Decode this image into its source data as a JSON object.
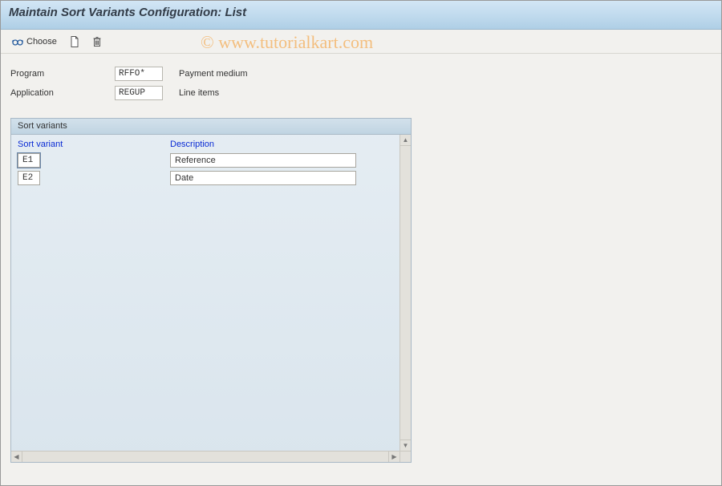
{
  "title_bar": {
    "title": "Maintain Sort Variants Configuration: List"
  },
  "toolbar": {
    "choose_label": "Choose"
  },
  "form": {
    "program_label": "Program",
    "program_value": "RFFO*",
    "program_desc": "Payment medium",
    "application_label": "Application",
    "application_value": "REGUP",
    "application_desc": "Line items"
  },
  "panel": {
    "title": "Sort variants",
    "col_sort_variant": "Sort variant",
    "col_description": "Description",
    "rows": [
      {
        "code": "E1",
        "desc": "Reference"
      },
      {
        "code": "E2",
        "desc": "Date"
      }
    ]
  },
  "watermark": "© www.tutorialkart.com"
}
